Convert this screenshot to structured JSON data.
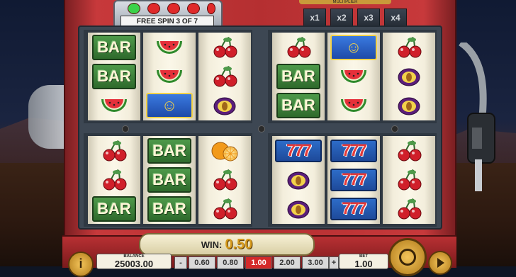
{
  "header": {
    "free_spin_label": "FREE SPIN 3 OF 7",
    "indicator_lights": [
      "green",
      "red",
      "red",
      "red",
      "red"
    ],
    "multiplier_title": "MULTIPLIER",
    "multipliers": [
      "x1",
      "x2",
      "x3",
      "x4"
    ]
  },
  "grids": [
    {
      "id": "top-left",
      "reels": [
        [
          "BAR",
          "BAR",
          "watermelon"
        ],
        [
          "watermelon",
          "watermelon",
          "WILD"
        ],
        [
          "cherry",
          "cherry",
          "plum"
        ]
      ]
    },
    {
      "id": "top-right",
      "reels": [
        [
          "cherry",
          "BAR",
          "BAR"
        ],
        [
          "WILD",
          "watermelon",
          "watermelon"
        ],
        [
          "cherry",
          "plum",
          "plum"
        ]
      ]
    },
    {
      "id": "bottom-left",
      "reels": [
        [
          "cherry",
          "cherry",
          "BAR"
        ],
        [
          "BAR",
          "BAR",
          "BAR"
        ],
        [
          "orange",
          "cherry",
          "cherry"
        ]
      ]
    },
    {
      "id": "bottom-right",
      "reels": [
        [
          "777",
          "plum",
          "plum"
        ],
        [
          "777",
          "777",
          "777"
        ],
        [
          "cherry",
          "cherry",
          "cherry"
        ]
      ]
    }
  ],
  "win": {
    "label": "WIN:",
    "value": "0.50"
  },
  "balance": {
    "label": "BALANCE",
    "value": "25003.00"
  },
  "bet_chips": {
    "minus": "-",
    "plus": "+",
    "values": [
      "0.60",
      "0.80",
      "1.00",
      "2.00",
      "3.00"
    ],
    "selected": "1.00"
  },
  "bet": {
    "label": "BET",
    "value": "1.00"
  },
  "buttons": {
    "info": "i"
  },
  "colors": {
    "cabinet": "#b52f31",
    "win_value": "#d69a1c",
    "selected_bet": "#d42a2a"
  }
}
